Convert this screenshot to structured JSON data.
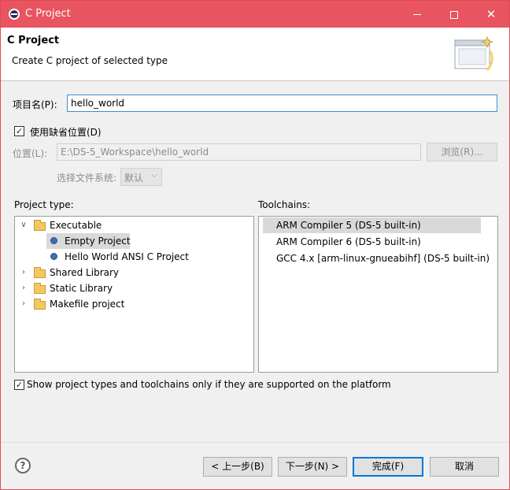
{
  "window": {
    "title": "C Project",
    "controls": {
      "minimize_icon": "minimize-icon",
      "maximize_icon": "maximize-icon",
      "close_glyph": "✕"
    }
  },
  "banner": {
    "title": "C Project",
    "description": "Create C project of selected type"
  },
  "project_name": {
    "label": "项目名(P):",
    "value": "hello_world"
  },
  "use_default_location": {
    "label": "使用缺省位置(D)",
    "checked": true
  },
  "location": {
    "label": "位置(L):",
    "value": "E:\\DS-5_Workspace\\hello_world",
    "browse_label": "浏览(R)..."
  },
  "filesystem": {
    "label": "选择文件系统:",
    "selected": "默认"
  },
  "project_type": {
    "label": "Project type:",
    "items": [
      {
        "label": "Executable",
        "kind": "folder",
        "expanded": true,
        "level": 0
      },
      {
        "label": "Empty Project",
        "kind": "leaf",
        "level": 1,
        "selected": true
      },
      {
        "label": "Hello World ANSI C Project",
        "kind": "leaf",
        "level": 1
      },
      {
        "label": "Shared Library",
        "kind": "folder",
        "expanded": false,
        "level": 0
      },
      {
        "label": "Static Library",
        "kind": "folder",
        "expanded": false,
        "level": 0
      },
      {
        "label": "Makefile project",
        "kind": "folder",
        "expanded": false,
        "level": 0
      }
    ]
  },
  "toolchains": {
    "label": "Toolchains:",
    "items": [
      {
        "label": "ARM Compiler 5 (DS-5 built-in)",
        "selected": true
      },
      {
        "label": "ARM Compiler 6 (DS-5 built-in)"
      },
      {
        "label": "GCC 4.x [arm-linux-gnueabihf] (DS-5 built-in)"
      }
    ]
  },
  "show_supported": {
    "label": "Show project types and toolchains only if they are supported on the platform",
    "checked": true
  },
  "footer": {
    "help_glyph": "?",
    "back_label": "< 上一步(B)",
    "next_label": "下一步(N) >",
    "finish_label": "完成(F)",
    "cancel_label": "取消"
  },
  "colors": {
    "titlebar": "#e8545f",
    "accent": "#0078d7",
    "selection": "#d9d9d9"
  }
}
